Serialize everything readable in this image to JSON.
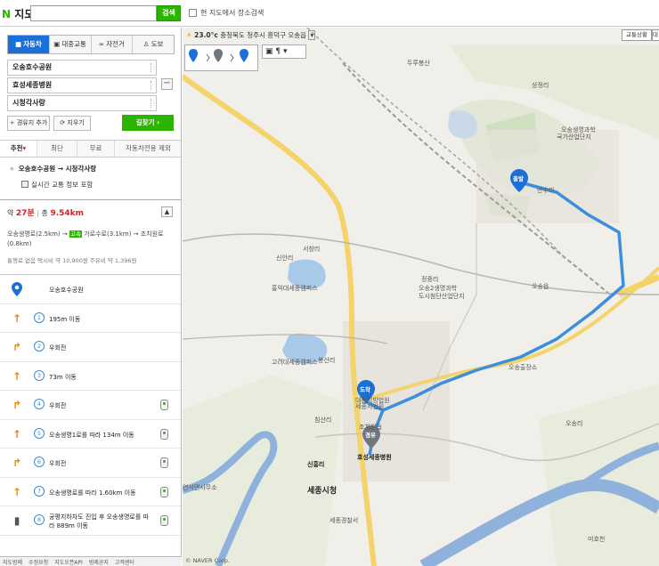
{
  "header": {
    "logo_text": "지도",
    "search_placeholder": "",
    "search_button": "검색",
    "area_search_label": "현 지도에서 장소검색"
  },
  "modes": [
    {
      "icon": "car-icon",
      "label": "자동차",
      "active": true
    },
    {
      "icon": "bus-icon",
      "label": "대중교통",
      "active": false
    },
    {
      "icon": "bike-icon",
      "label": "자전거",
      "active": false
    },
    {
      "icon": "walk-icon",
      "label": "도보",
      "active": false
    }
  ],
  "route_form": {
    "origin": "오송호수공원",
    "waypoint": "효성세종병원",
    "destination": "시청각사랑",
    "add_waypoint": "경유지 추가",
    "clear": "지우기",
    "search": "길찾기"
  },
  "options": [
    "추천",
    "최단",
    "무료",
    "자동차전용 제외"
  ],
  "selected_route": {
    "title": "오송호수공원 → 시청각사랑",
    "live_traffic": "실시간 교통 정보 포함"
  },
  "summary": {
    "time_prefix": "약",
    "time": "27분",
    "dist_prefix": "총",
    "dist": "9.54km",
    "detail_a": "오송생명로(2.5km) →",
    "detail_badge": "고속",
    "detail_b": "가로수로(3.1km) → 조치원로",
    "detail_c": "(0.8km)",
    "fare": "통행료 없음  택시비 약 10,900원  주유비 약 1,396원"
  },
  "start_label": "오송호수공원",
  "steps": [
    {
      "num": "1",
      "dir": "straight",
      "text": "195m 이동",
      "cam": false
    },
    {
      "num": "2",
      "dir": "right",
      "text": "우회전",
      "cam": false
    },
    {
      "num": "3",
      "dir": "straight",
      "text": "73m 이동",
      "cam": false
    },
    {
      "num": "4",
      "dir": "right",
      "text": "우회전",
      "cam": true
    },
    {
      "num": "5",
      "dir": "straight",
      "text": "오송생명1로를 따라 134m 이동",
      "cam": true
    },
    {
      "num": "6",
      "dir": "right",
      "text": "우회전",
      "cam": true
    },
    {
      "num": "7",
      "dir": "straight",
      "text": "오송생명로를 따라 1.60km 이동",
      "cam": true
    },
    {
      "num": "8",
      "dir": "tunnel",
      "text": "궁평지하차도 진입 후 오송생명로를 따라 889m 이동",
      "cam": true
    }
  ],
  "footer": [
    "지도범례",
    "수정요청",
    "지도오픈API",
    "범례공지",
    "고객센터"
  ],
  "map": {
    "weather_temp": "23.0°c",
    "weather_loc": "충청북도 청주시 흥덕구 오송읍",
    "traffic_btn": "교통상황",
    "copyright": "© NAVER Corp.",
    "markers": {
      "start": "출발",
      "waypoint": "경유",
      "end": "도착"
    },
    "labels": [
      "두루봉산",
      "상정리",
      "오송생명과학",
      "국가산업단지",
      "만수리",
      "정중리",
      "오송2생명과학",
      "도시첨단산업단지",
      "신안리",
      "서창리",
      "홍익대세종캠퍼스",
      "고려대세종캠퍼스",
      "봉산리",
      "오송읍",
      "오송출장소",
      "오송리",
      "대전지방법원",
      "세종시법원",
      "조치원읍",
      "침산리",
      "효성세종병원",
      "신흥리",
      "세종시청",
      "연서면사무소",
      "세종경찰서",
      "미호천"
    ],
    "route_color": "#3d8edb"
  }
}
